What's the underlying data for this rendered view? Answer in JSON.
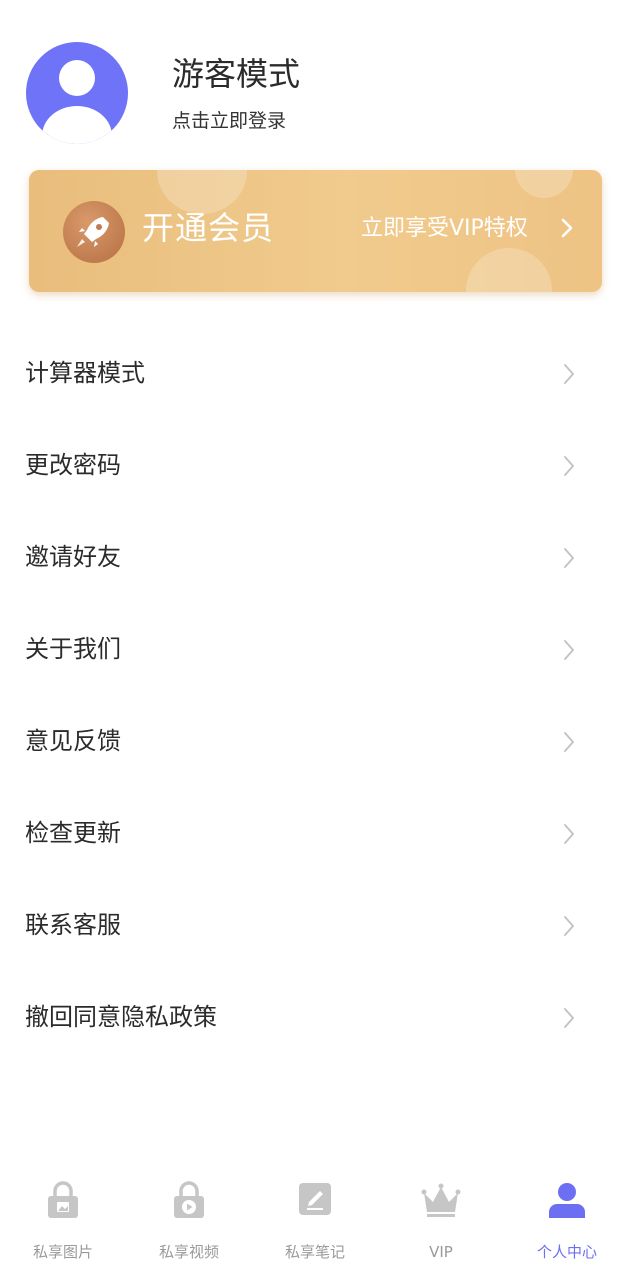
{
  "profile": {
    "name": "游客模式",
    "subtitle": "点击立即登录",
    "avatar_icon": "user-avatar-icon",
    "avatar_color": "#6f73f7"
  },
  "vip_banner": {
    "title": "开通会员",
    "cta": "立即享受VIP特权",
    "icon": "rocket-icon",
    "colors": {
      "background": "#efc686",
      "text": "#ffffff",
      "badge": "#c27a4e"
    }
  },
  "menu": {
    "items": [
      {
        "label": "计算器模式"
      },
      {
        "label": "更改密码"
      },
      {
        "label": "邀请好友"
      },
      {
        "label": "关于我们"
      },
      {
        "label": "意见反馈"
      },
      {
        "label": "检查更新"
      },
      {
        "label": "联系客服"
      },
      {
        "label": "撤回同意隐私政策"
      }
    ]
  },
  "tabbar": {
    "tabs": [
      {
        "label": "私享图片",
        "icon": "lock-image-icon",
        "active": false
      },
      {
        "label": "私享视频",
        "icon": "lock-video-icon",
        "active": false
      },
      {
        "label": "私享笔记",
        "icon": "edit-note-icon",
        "active": false
      },
      {
        "label": "VIP",
        "icon": "crown-icon",
        "active": false
      },
      {
        "label": "个人中心",
        "icon": "person-icon",
        "active": true
      }
    ],
    "colors": {
      "inactive": "#c6c6c6",
      "active": "#6c6ff2"
    }
  }
}
